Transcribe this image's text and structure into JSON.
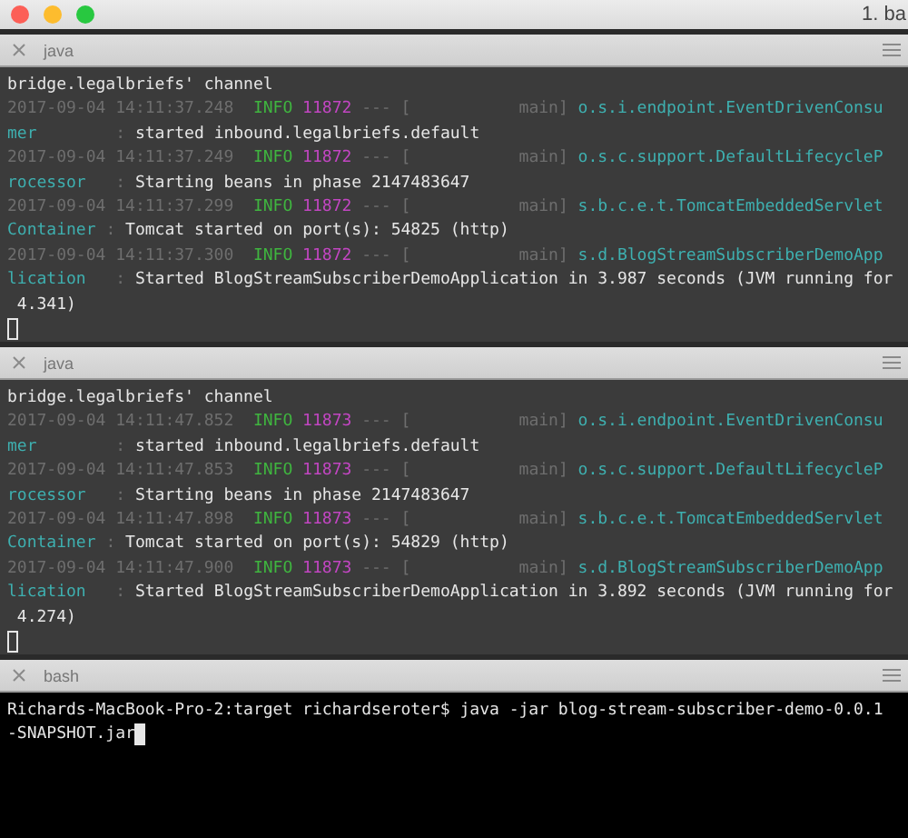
{
  "window": {
    "title": "1. ba"
  },
  "panes": [
    {
      "title": "java",
      "active": false,
      "lines": [
        [
          {
            "kind": "text",
            "text": "bridge.legalbriefs' channel"
          }
        ],
        [
          {
            "kind": "timestamp",
            "text": "2017-09-04 14:11:37.248"
          },
          {
            "kind": "level",
            "text": "  INFO"
          },
          {
            "kind": "pid",
            "text": " 11872"
          },
          {
            "kind": "dim",
            "text": " --- [           main]"
          },
          {
            "kind": "logger",
            "text": " o.s.i.endpoint.EventDrivenConsu"
          }
        ],
        [
          {
            "kind": "logger",
            "text": "mer"
          },
          {
            "kind": "dim",
            "text": "        :"
          },
          {
            "kind": "text",
            "text": " started inbound.legalbriefs.default"
          }
        ],
        [
          {
            "kind": "timestamp",
            "text": "2017-09-04 14:11:37.249"
          },
          {
            "kind": "level",
            "text": "  INFO"
          },
          {
            "kind": "pid",
            "text": " 11872"
          },
          {
            "kind": "dim",
            "text": " --- [           main]"
          },
          {
            "kind": "logger",
            "text": " o.s.c.support.DefaultLifecycleP"
          }
        ],
        [
          {
            "kind": "logger",
            "text": "rocessor"
          },
          {
            "kind": "dim",
            "text": "   :"
          },
          {
            "kind": "text",
            "text": " Starting beans in phase 2147483647"
          }
        ],
        [
          {
            "kind": "timestamp",
            "text": "2017-09-04 14:11:37.299"
          },
          {
            "kind": "level",
            "text": "  INFO"
          },
          {
            "kind": "pid",
            "text": " 11872"
          },
          {
            "kind": "dim",
            "text": " --- [           main]"
          },
          {
            "kind": "logger",
            "text": " s.b.c.e.t.TomcatEmbeddedServlet"
          }
        ],
        [
          {
            "kind": "logger",
            "text": "Container"
          },
          {
            "kind": "dim",
            "text": " :"
          },
          {
            "kind": "text",
            "text": " Tomcat started on port(s): 54825 (http)"
          }
        ],
        [
          {
            "kind": "timestamp",
            "text": "2017-09-04 14:11:37.300"
          },
          {
            "kind": "level",
            "text": "  INFO"
          },
          {
            "kind": "pid",
            "text": " 11872"
          },
          {
            "kind": "dim",
            "text": " --- [           main]"
          },
          {
            "kind": "logger",
            "text": " s.d.BlogStreamSubscriberDemoApp"
          }
        ],
        [
          {
            "kind": "logger",
            "text": "lication"
          },
          {
            "kind": "dim",
            "text": "   :"
          },
          {
            "kind": "text",
            "text": " Started BlogStreamSubscriberDemoApplication in 3.987 seconds (JVM running for"
          }
        ],
        [
          {
            "kind": "text",
            "text": " 4.341)"
          }
        ]
      ]
    },
    {
      "title": "java",
      "active": false,
      "lines": [
        [
          {
            "kind": "text",
            "text": "bridge.legalbriefs' channel"
          }
        ],
        [
          {
            "kind": "timestamp",
            "text": "2017-09-04 14:11:47.852"
          },
          {
            "kind": "level",
            "text": "  INFO"
          },
          {
            "kind": "pid",
            "text": " 11873"
          },
          {
            "kind": "dim",
            "text": " --- [           main]"
          },
          {
            "kind": "logger",
            "text": " o.s.i.endpoint.EventDrivenConsu"
          }
        ],
        [
          {
            "kind": "logger",
            "text": "mer"
          },
          {
            "kind": "dim",
            "text": "        :"
          },
          {
            "kind": "text",
            "text": " started inbound.legalbriefs.default"
          }
        ],
        [
          {
            "kind": "timestamp",
            "text": "2017-09-04 14:11:47.853"
          },
          {
            "kind": "level",
            "text": "  INFO"
          },
          {
            "kind": "pid",
            "text": " 11873"
          },
          {
            "kind": "dim",
            "text": " --- [           main]"
          },
          {
            "kind": "logger",
            "text": " o.s.c.support.DefaultLifecycleP"
          }
        ],
        [
          {
            "kind": "logger",
            "text": "rocessor"
          },
          {
            "kind": "dim",
            "text": "   :"
          },
          {
            "kind": "text",
            "text": " Starting beans in phase 2147483647"
          }
        ],
        [
          {
            "kind": "timestamp",
            "text": "2017-09-04 14:11:47.898"
          },
          {
            "kind": "level",
            "text": "  INFO"
          },
          {
            "kind": "pid",
            "text": " 11873"
          },
          {
            "kind": "dim",
            "text": " --- [           main]"
          },
          {
            "kind": "logger",
            "text": " s.b.c.e.t.TomcatEmbeddedServlet"
          }
        ],
        [
          {
            "kind": "logger",
            "text": "Container"
          },
          {
            "kind": "dim",
            "text": " :"
          },
          {
            "kind": "text",
            "text": " Tomcat started on port(s): 54829 (http)"
          }
        ],
        [
          {
            "kind": "timestamp",
            "text": "2017-09-04 14:11:47.900"
          },
          {
            "kind": "level",
            "text": "  INFO"
          },
          {
            "kind": "pid",
            "text": " 11873"
          },
          {
            "kind": "dim",
            "text": " --- [           main]"
          },
          {
            "kind": "logger",
            "text": " s.d.BlogStreamSubscriberDemoApp"
          }
        ],
        [
          {
            "kind": "logger",
            "text": "lication"
          },
          {
            "kind": "dim",
            "text": "   :"
          },
          {
            "kind": "text",
            "text": " Started BlogStreamSubscriberDemoApplication in 3.892 seconds (JVM running for"
          }
        ],
        [
          {
            "kind": "text",
            "text": " 4.274)"
          }
        ]
      ]
    },
    {
      "title": "bash",
      "active": true,
      "lines": [
        [
          {
            "kind": "text",
            "text": "Richards-MacBook-Pro-2:target richardseroter$ java -jar blog-stream-subscriber-demo-0.0.1"
          }
        ],
        [
          {
            "kind": "text",
            "text": "-SNAPSHOT.jar"
          }
        ]
      ]
    }
  ]
}
